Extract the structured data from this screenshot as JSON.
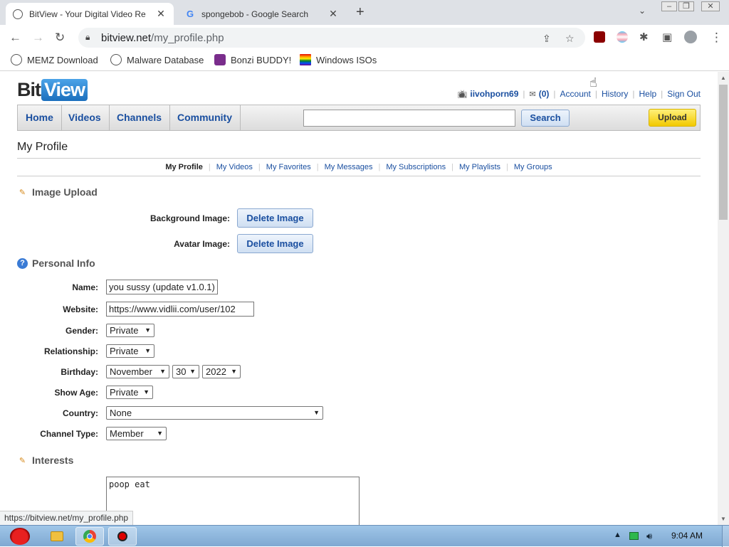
{
  "browser": {
    "tabs": [
      {
        "title": "BitView - Your Digital Video Re",
        "active": true
      },
      {
        "title": "spongebob - Google Search",
        "active": false
      }
    ],
    "url_host": "bitview.net",
    "url_path": "/my_profile.php",
    "bookmarks": [
      "MEMZ Download",
      "Malware Database",
      "Bonzi BUDDY!",
      "Windows ISOs"
    ],
    "status_url": "https://bitview.net/my_profile.php"
  },
  "site": {
    "logo_bit": "Bit",
    "logo_view": "View",
    "username": "iivohporn69",
    "messages_count": "(0)",
    "links": [
      "Account",
      "History",
      "Help",
      "Sign Out"
    ],
    "nav": [
      "Home",
      "Videos",
      "Channels",
      "Community"
    ],
    "search_label": "Search",
    "upload_label": "Upload"
  },
  "page": {
    "title": "My Profile",
    "subnav": [
      "My Profile",
      "My Videos",
      "My Favorites",
      "My Messages",
      "My Subscriptions",
      "My Playlists",
      "My Groups"
    ],
    "image_upload": {
      "heading": "Image Upload",
      "background_label": "Background Image:",
      "avatar_label": "Avatar Image:",
      "delete_label": "Delete Image"
    },
    "personal_info": {
      "heading": "Personal Info",
      "name_label": "Name:",
      "name_value": "you sussy (update v1.0.1)",
      "website_label": "Website:",
      "website_value": "https://www.vidlii.com/user/102",
      "gender_label": "Gender:",
      "gender_value": "Private",
      "relationship_label": "Relationship:",
      "relationship_value": "Private",
      "birthday_label": "Birthday:",
      "birthday_month": "November",
      "birthday_day": "30",
      "birthday_year": "2022",
      "showage_label": "Show Age:",
      "showage_value": "Private",
      "country_label": "Country:",
      "country_value": "None",
      "channeltype_label": "Channel Type:",
      "channeltype_value": "Member"
    },
    "interests": {
      "heading": "Interests",
      "value": "poop eat"
    }
  },
  "taskbar": {
    "clock": "9:04 AM"
  }
}
